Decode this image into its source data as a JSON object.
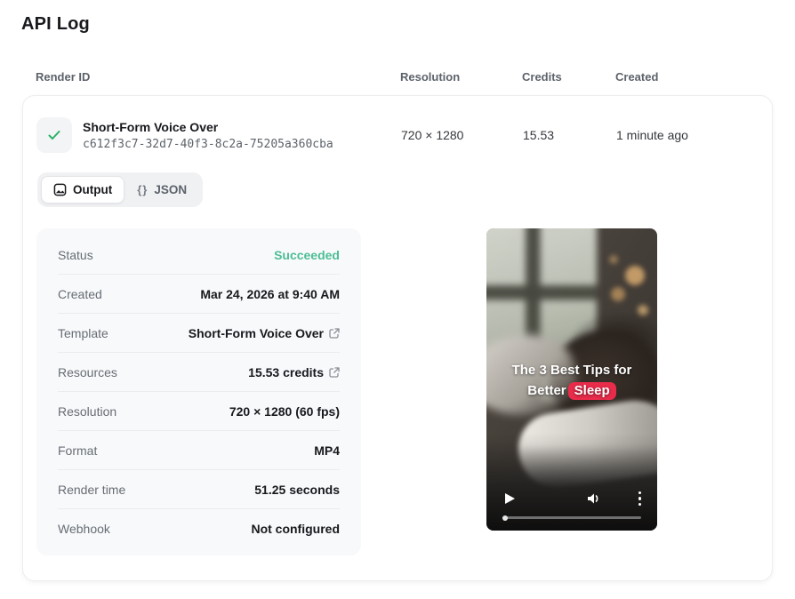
{
  "page": {
    "title": "API Log"
  },
  "table": {
    "headers": [
      "Render ID",
      "Resolution",
      "Credits",
      "Created"
    ],
    "row": {
      "name": "Short-Form Voice Over",
      "render_id": "c612f3c7-32d7-40f3-8c2a-75205a360cba",
      "resolution": "720 × 1280",
      "credits": "15.53",
      "created": "1 minute ago"
    }
  },
  "tabs": {
    "output_label": "Output",
    "json_label": "JSON",
    "json_icon_glyph": "{}"
  },
  "details": {
    "rows": [
      {
        "label": "Status",
        "value": "Succeeded"
      },
      {
        "label": "Created",
        "value": "Mar 24, 2026 at 9:40 AM"
      },
      {
        "label": "Template",
        "value": "Short-Form Voice Over"
      },
      {
        "label": "Resources",
        "value": "15.53 credits"
      },
      {
        "label": "Resolution",
        "value": "720 × 1280 (60 fps)"
      },
      {
        "label": "Format",
        "value": "MP4"
      },
      {
        "label": "Render time",
        "value": "51.25 seconds"
      },
      {
        "label": "Webhook",
        "value": "Not configured"
      }
    ]
  },
  "video": {
    "caption_line1": "The 3 Best Tips for",
    "caption_line2_prefix": "Better",
    "caption_highlight": "Sleep"
  },
  "colors": {
    "status_success": "#4cbe95",
    "check_green": "#2bb169",
    "highlight_red": "#ea2c4b"
  }
}
